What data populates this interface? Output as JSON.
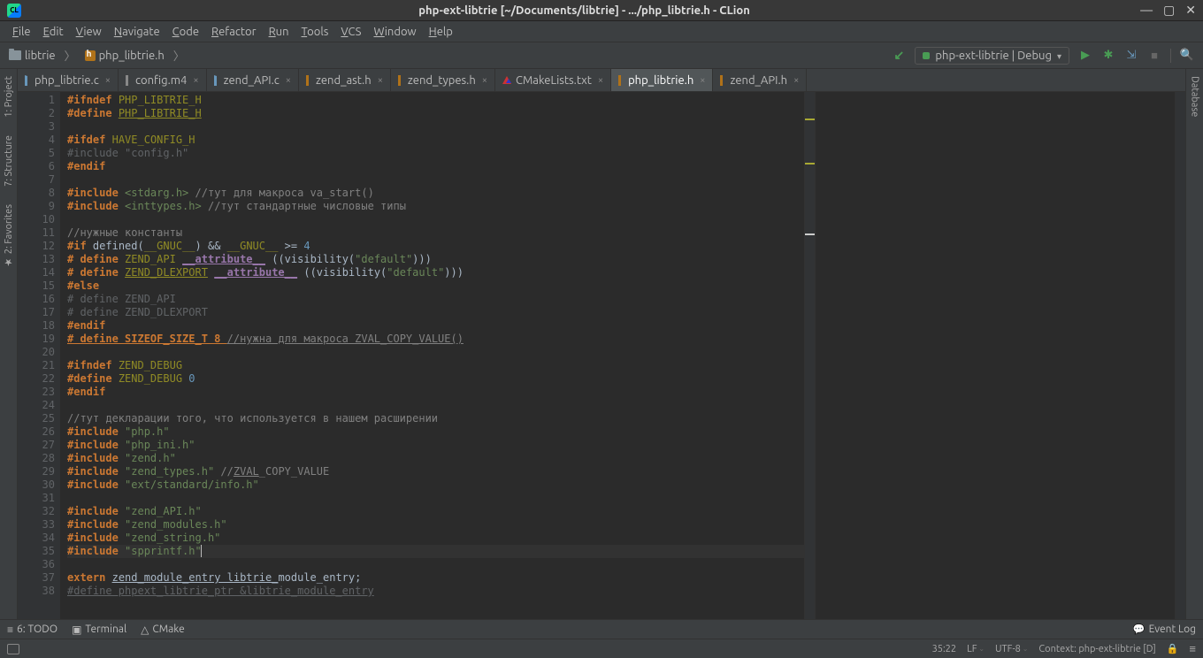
{
  "title": "php-ext-libtrie [~/Documents/libtrie] - .../php_libtrie.h - CLion",
  "logo_text": "CL",
  "menu": [
    "File",
    "Edit",
    "View",
    "Navigate",
    "Code",
    "Refactor",
    "Run",
    "Tools",
    "VCS",
    "Window",
    "Help"
  ],
  "breadcrumb": [
    {
      "label": "libtrie",
      "type": "folder"
    },
    {
      "label": "php_libtrie.h",
      "type": "h"
    }
  ],
  "run_config": "php-ext-libtrie | Debug",
  "tabs": [
    {
      "label": "php_libtrie.c",
      "ico": "c",
      "active": false
    },
    {
      "label": "config.m4",
      "ico": "m4",
      "active": false
    },
    {
      "label": "zend_API.c",
      "ico": "c",
      "active": false
    },
    {
      "label": "zend_ast.h",
      "ico": "h",
      "active": false
    },
    {
      "label": "zend_types.h",
      "ico": "h",
      "active": false
    },
    {
      "label": "CMakeLists.txt",
      "ico": "cm",
      "active": false
    },
    {
      "label": "php_libtrie.h",
      "ico": "h",
      "active": true
    },
    {
      "label": "zend_API.h",
      "ico": "h",
      "active": false
    }
  ],
  "side_left": [
    "1: Project",
    "7: Structure",
    "2: Favorites"
  ],
  "side_right": [
    "Database"
  ],
  "code_lines": [
    {
      "n": 1,
      "html": "<span class='k-pp'>#ifndef</span> <span class='k-mc'>PHP_LIBTRIE_H</span>"
    },
    {
      "n": 2,
      "html": "<span class='k-pp'>#define</span> <span class='k-mc k-ul'>PHP_LIBTRIE_H</span>"
    },
    {
      "n": 3,
      "html": ""
    },
    {
      "n": 4,
      "html": "<span class='k-pp'>#ifdef</span> <span class='k-mc'>HAVE_CONFIG_H</span>"
    },
    {
      "n": 5,
      "html": "<span class='k-dim'>#include </span><span class='k-dim'>\"config.h\"</span>"
    },
    {
      "n": 6,
      "html": "<span class='k-pp'>#endif</span>"
    },
    {
      "n": 7,
      "html": ""
    },
    {
      "n": 8,
      "html": "<span class='k-pp'>#include</span> <span class='k-ang'>&lt;stdarg.h&gt;</span> <span class='k-cmt'>//тут для макроса va_start()</span>"
    },
    {
      "n": 9,
      "html": "<span class='k-pp'>#include</span> <span class='k-ang'>&lt;inttypes.h&gt;</span> <span class='k-cmt'>//тут стандартные числовые типы</span>"
    },
    {
      "n": 10,
      "html": ""
    },
    {
      "n": 11,
      "html": "<span class='k-cmt'>//нужные константы</span>"
    },
    {
      "n": 12,
      "html": "<span class='k-pp'>#if</span> <span class='k-ident'>defined(</span><span class='k-mc'>__GNUC__</span><span class='k-ident'>) &amp;&amp; </span><span class='k-mc'>__GNUC__</span><span class='k-ident'> &gt;= </span><span class='k-num'>4</span>"
    },
    {
      "n": 13,
      "html": "<span class='k-pp'># define</span> <span class='k-mc'>ZEND_API</span> <span class='k-attr'>__attribute__</span> <span class='k-braces'>((visibility(</span><span class='k-str'>\"default\"</span><span class='k-braces'>)))</span>"
    },
    {
      "n": 14,
      "html": "<span class='k-pp'># define</span> <span class='k-mc k-ul'>ZEND_DLEXPORT</span> <span class='k-attr'>__attribute__</span> <span class='k-braces'>((visibility(</span><span class='k-str'>\"default\"</span><span class='k-braces'>)))</span>"
    },
    {
      "n": 15,
      "html": "<span class='k-pp'>#else</span>"
    },
    {
      "n": 16,
      "html": "<span class='k-dim'># define ZEND_API</span>"
    },
    {
      "n": 17,
      "html": "<span class='k-dim'># define ZEND_DLEXPORT</span>"
    },
    {
      "n": 18,
      "html": "<span class='k-pp'>#endif</span>"
    },
    {
      "n": 19,
      "html": "<span class='k-pp k-ul'># define SIZEOF_SIZE_T 8 </span><span class='k-cmt k-ul'>//нужна для макроса ZVAL_COPY_VALUE()</span>"
    },
    {
      "n": 20,
      "html": ""
    },
    {
      "n": 21,
      "html": "<span class='k-pp'>#ifndef</span> <span class='k-mc'>ZEND_DEBUG</span>"
    },
    {
      "n": 22,
      "html": "<span class='k-pp'>#define</span> <span class='k-mc'>ZEND_DEBUG</span> <span class='k-num'>0</span>"
    },
    {
      "n": 23,
      "html": "<span class='k-pp'>#endif</span>"
    },
    {
      "n": 24,
      "html": ""
    },
    {
      "n": 25,
      "html": "<span class='k-cmt'>//тут декларации того, что используется в нашем расширении</span>"
    },
    {
      "n": 26,
      "html": "<span class='k-pp'>#include</span> <span class='k-str'>\"php.h\"</span>"
    },
    {
      "n": 27,
      "html": "<span class='k-pp'>#include</span> <span class='k-str'>\"php_ini.h\"</span>"
    },
    {
      "n": 28,
      "html": "<span class='k-pp'>#include</span> <span class='k-str'>\"zend.h\"</span>"
    },
    {
      "n": 29,
      "html": "<span class='k-pp'>#include</span> <span class='k-str'>\"zend_types.h\"</span> <span class='k-cmt'>//<span class='k-ul'>ZVAL</span>_COPY_VALUE</span>"
    },
    {
      "n": 30,
      "html": "<span class='k-pp'>#include</span> <span class='k-str'>\"ext/standard/info.h\"</span>"
    },
    {
      "n": 31,
      "html": ""
    },
    {
      "n": 32,
      "html": "<span class='k-pp'>#include</span> <span class='k-str'>\"zend_API.h\"</span>"
    },
    {
      "n": 33,
      "html": "<span class='k-pp'>#include</span> <span class='k-str'>\"zend_modules.h\"</span>"
    },
    {
      "n": 34,
      "html": "<span class='k-pp'>#include</span> <span class='k-str'>\"zend_string.h\"</span>"
    },
    {
      "n": 35,
      "html": "<span class='line-hl'><span class='k-pp'>#include</span> <span class='k-str'>\"spprintf.h\"</span><span class='caret'></span></span>"
    },
    {
      "n": 36,
      "html": ""
    },
    {
      "n": 37,
      "html": "<span class='k-kw'>extern</span> <span class='k-ident k-ul'>zend_module_entry libtrie_</span><span class='k-ident'>module_entry;</span>"
    },
    {
      "n": 38,
      "html": "<span class='k-dim k-ul'>#define phpext_libtrie_ptr &amp;libtrie_module_entry</span>"
    }
  ],
  "bottom_tools": {
    "todo": "6: TODO",
    "terminal": "Terminal",
    "cmake": "CMake",
    "event_log": "Event Log"
  },
  "status": {
    "pos": "35:22",
    "le": "LF",
    "enc": "UTF-8",
    "ctx": "Context: php-ext-libtrie [D]"
  }
}
